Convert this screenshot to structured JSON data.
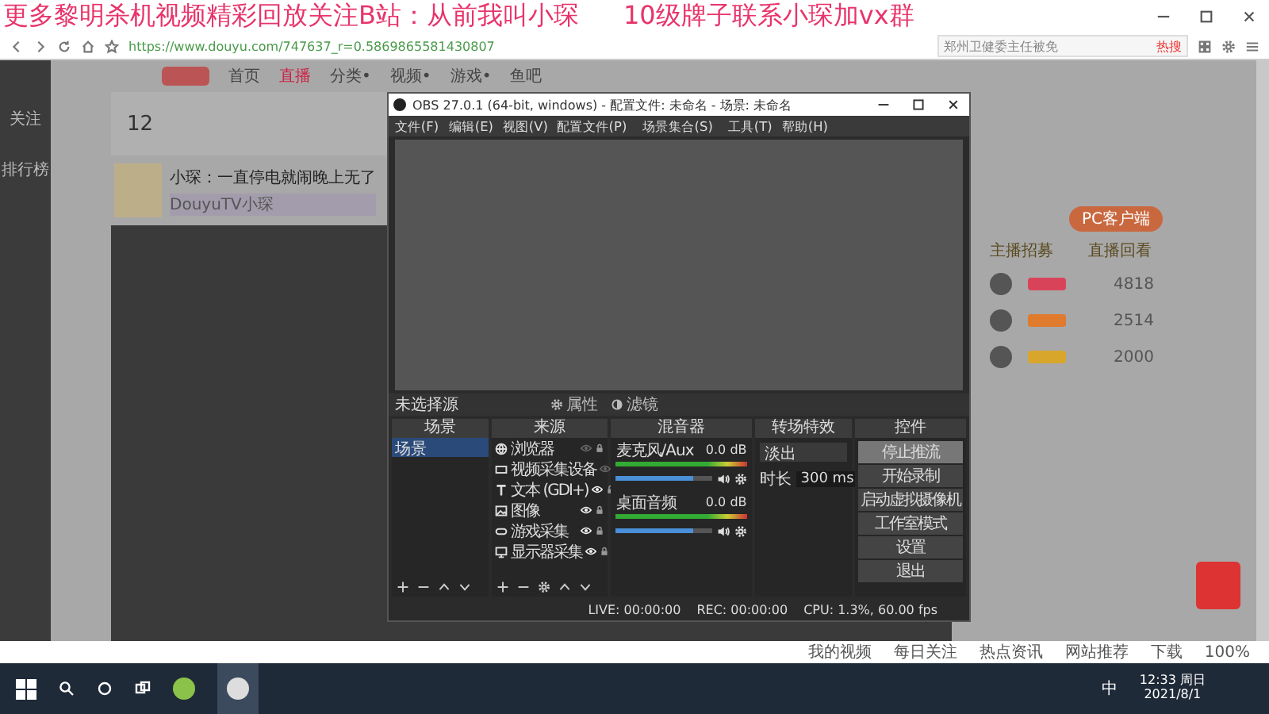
{
  "overlay_banner": {
    "lead": "更多黎明杀机视频精彩回放关注B站：从前我叫小琛",
    "tail": "10级牌子联系小琛加vx群"
  },
  "browser": {
    "url": "https://www.douyu.com/747637_r=0.5869865581430807",
    "search_text": "郑州卫健委主任被免",
    "hot_badge": "热搜"
  },
  "site": {
    "nav": [
      {
        "label": "首页",
        "selected": false
      },
      {
        "label": "直播",
        "selected": true
      },
      {
        "label": "分类•",
        "selected": false
      },
      {
        "label": "视频•",
        "selected": false
      },
      {
        "label": "游戏•",
        "selected": false
      },
      {
        "label": "鱼吧",
        "selected": false
      }
    ],
    "sidebar": [
      "关注",
      "排行榜"
    ],
    "follow_count": "12",
    "stream_title": "小琛：一直停电就闹晚上无了",
    "channel": "DouyuTV小琛",
    "client_button": "PC客户端",
    "recruit": "主播招募",
    "replay": "直播回看",
    "ranks": [
      {
        "score": "4818",
        "color": "#d9435a"
      },
      {
        "score": "2514",
        "color": "#e07a2c"
      },
      {
        "score": "2000",
        "color": "#d9a62c"
      }
    ]
  },
  "obs": {
    "title": "OBS 27.0.1 (64-bit, windows) - 配置文件: 未命名 - 场景: 未命名",
    "menu": [
      "文件(F)",
      "编辑(E)",
      "视图(V)",
      "配置文件(P)",
      "场景集合(S)",
      "工具(T)",
      "帮助(H)"
    ],
    "toolbar": {
      "label": "未选择源",
      "properties": "属性",
      "filters": "滤镜"
    },
    "docks": {
      "scenes": "场景",
      "sources": "来源",
      "mixer": "混音器",
      "transitions": "转场特效",
      "controls": "控件"
    },
    "scenes": [
      {
        "name": "场景",
        "selected": true
      }
    ],
    "sources": [
      {
        "name": "浏览器",
        "kind": "globe",
        "visible": false
      },
      {
        "name": "视频采集设备",
        "kind": "camera",
        "visible": false
      },
      {
        "name": "文本 (GDI+)",
        "kind": "text",
        "visible": true
      },
      {
        "name": "图像",
        "kind": "image",
        "visible": true
      },
      {
        "name": "游戏采集",
        "kind": "gamepad",
        "visible": true
      },
      {
        "name": "显示器采集",
        "kind": "monitor",
        "visible": true
      }
    ],
    "mixer": [
      {
        "name": "麦克风/Aux",
        "reading": "0.0 dB",
        "level": 0.8
      },
      {
        "name": "桌面音频",
        "reading": "0.0 dB",
        "level": 0.8
      }
    ],
    "transition": {
      "value": "淡出",
      "duration_label": "时长",
      "duration": "300 ms"
    },
    "controls": [
      {
        "label": "停止推流",
        "active": true
      },
      {
        "label": "开始录制",
        "active": false
      },
      {
        "label": "启动虚拟摄像机",
        "active": false
      },
      {
        "label": "工作室模式",
        "active": false
      },
      {
        "label": "设置",
        "active": false
      },
      {
        "label": "退出",
        "active": false
      }
    ],
    "status": {
      "live": "LIVE: 00:00:00",
      "rec": "REC: 00:00:00",
      "cpu": "CPU: 1.3%, 60.00 fps"
    }
  },
  "status_bar": [
    "我的视频",
    "每日关注",
    "热点资讯",
    "网站推荐",
    "下载",
    "100%"
  ],
  "taskbar": {
    "ime": "中",
    "time": "12:33 周日",
    "date": "2021/8/1"
  }
}
